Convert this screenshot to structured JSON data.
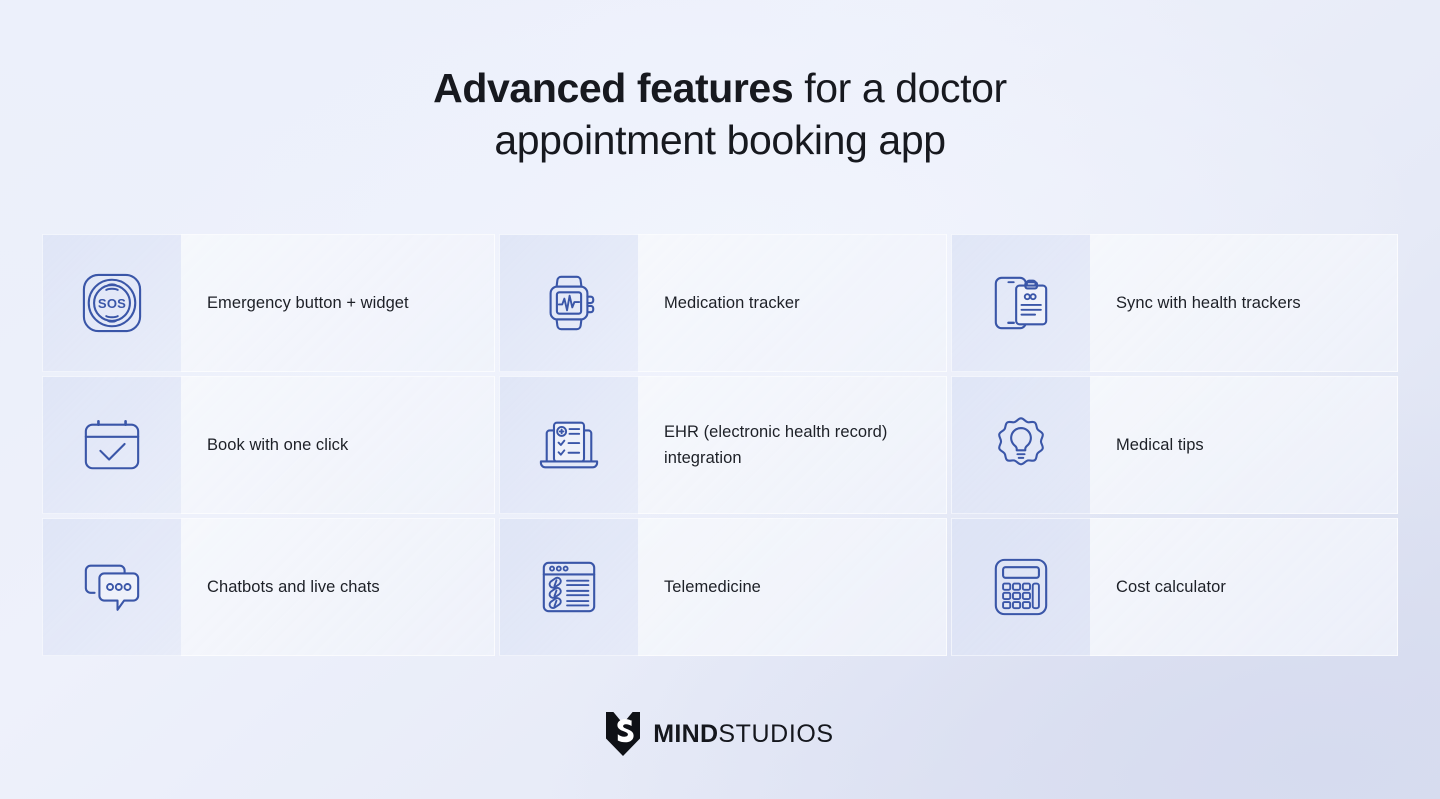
{
  "title": {
    "bold_part": "Advanced features",
    "rest": " for a doctor appointment booking app"
  },
  "colors": {
    "icon_stroke": "#3a56a8",
    "text": "#1d2027",
    "background_start": "#eaeef9",
    "background_end": "#dadff0",
    "logo": "#15171d"
  },
  "grid": {
    "rows": [
      {
        "left": {
          "icon": "sos-emergency-icon",
          "label": "Emergency button + widget"
        },
        "middle": {
          "icon": "smartwatch-heartbeat-icon",
          "label": "Medication tracker"
        },
        "right": {
          "icon": "phone-clipboard-sync-icon",
          "label": "Sync with health trackers"
        }
      },
      {
        "left": {
          "icon": "calendar-check-icon",
          "label": "Book with one click"
        },
        "middle": {
          "icon": "laptop-medical-record-icon",
          "label": "EHR (electronic health record) integration"
        },
        "right": {
          "icon": "lightbulb-badge-icon",
          "label": "Medical tips"
        }
      },
      {
        "left": {
          "icon": "chat-bubbles-icon",
          "label": "Chatbots and live chats"
        },
        "middle": {
          "icon": "browser-pill-list-icon",
          "label": "Telemedicine"
        },
        "right": {
          "icon": "calculator-icon",
          "label": "Cost calculator"
        }
      }
    ]
  },
  "footer": {
    "logo_mark": "mindstudios-shield-icon",
    "logo_bold": "MIND",
    "logo_regular": "STUDIOS"
  }
}
